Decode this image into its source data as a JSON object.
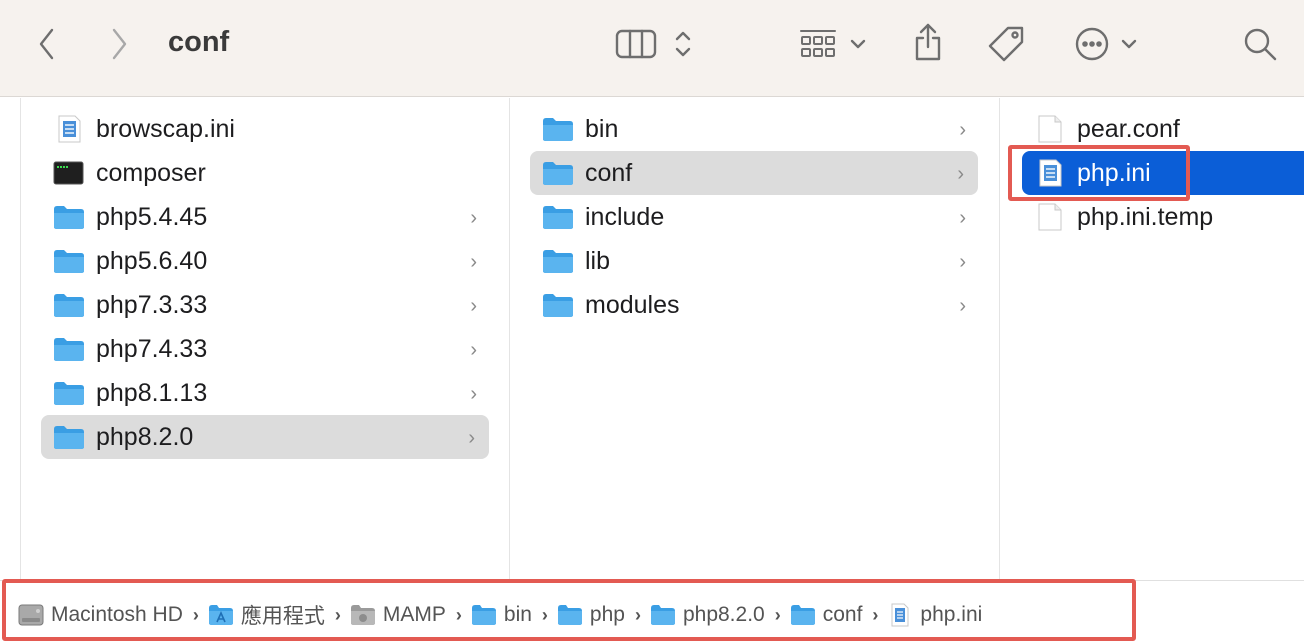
{
  "window": {
    "title": "conf"
  },
  "toolbar": {
    "back_icon": "chevron-left-icon",
    "forward_icon": "chevron-right-icon",
    "view_icon": "column-view-icon",
    "group_icon": "group-grid-icon",
    "share_icon": "share-icon",
    "tag_icon": "tag-icon",
    "more_icon": "more-ellipsis-icon",
    "search_icon": "search-icon"
  },
  "columns": [
    {
      "items": [
        {
          "label": "browscap.ini",
          "icon": "ini-document-icon",
          "has_children": false,
          "selected": false
        },
        {
          "label": "composer",
          "icon": "terminal-exec-icon",
          "has_children": false,
          "selected": false
        },
        {
          "label": "php5.4.45",
          "icon": "folder-icon",
          "has_children": true,
          "selected": false
        },
        {
          "label": "php5.6.40",
          "icon": "folder-icon",
          "has_children": true,
          "selected": false
        },
        {
          "label": "php7.3.33",
          "icon": "folder-icon",
          "has_children": true,
          "selected": false
        },
        {
          "label": "php7.4.33",
          "icon": "folder-icon",
          "has_children": true,
          "selected": false
        },
        {
          "label": "php8.1.13",
          "icon": "folder-icon",
          "has_children": true,
          "selected": false
        },
        {
          "label": "php8.2.0",
          "icon": "folder-icon",
          "has_children": true,
          "selected": true
        }
      ]
    },
    {
      "items": [
        {
          "label": "bin",
          "icon": "folder-icon",
          "has_children": true,
          "selected": false
        },
        {
          "label": "conf",
          "icon": "folder-icon",
          "has_children": true,
          "selected": true
        },
        {
          "label": "include",
          "icon": "folder-icon",
          "has_children": true,
          "selected": false
        },
        {
          "label": "lib",
          "icon": "folder-icon",
          "has_children": true,
          "selected": false
        },
        {
          "label": "modules",
          "icon": "folder-icon",
          "has_children": true,
          "selected": false
        }
      ]
    },
    {
      "items": [
        {
          "label": "pear.conf",
          "icon": "blank-document-icon",
          "selected": false
        },
        {
          "label": "php.ini",
          "icon": "ini-document-icon",
          "selected": true
        },
        {
          "label": "php.ini.temp",
          "icon": "blank-document-icon",
          "selected": false
        }
      ]
    }
  ],
  "pathbar": {
    "crumbs": [
      {
        "label": "Macintosh HD",
        "icon": "hard-drive-icon"
      },
      {
        "label": "應用程式",
        "icon": "applications-folder-icon"
      },
      {
        "label": "MAMP",
        "icon": "gray-folder-icon"
      },
      {
        "label": "bin",
        "icon": "folder-icon"
      },
      {
        "label": "php",
        "icon": "folder-icon"
      },
      {
        "label": "php8.2.0",
        "icon": "folder-icon"
      },
      {
        "label": "conf",
        "icon": "folder-icon"
      },
      {
        "label": "php.ini",
        "icon": "ini-document-icon"
      }
    ]
  },
  "colors": {
    "folder": "#5ab4ef",
    "selection_blue": "#0b5ed7",
    "selection_gray": "#dcdcdc",
    "highlight_red": "#e35a52"
  }
}
